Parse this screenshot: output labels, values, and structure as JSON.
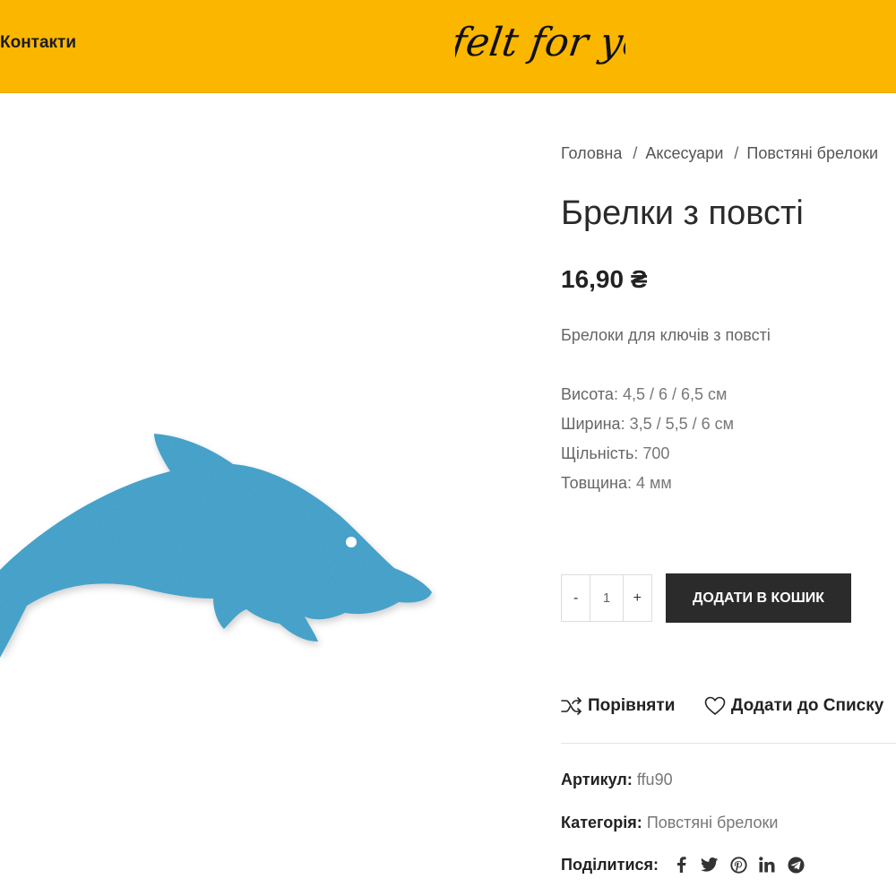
{
  "header": {
    "nav_contacts": "Контакти",
    "logo_text": "felt for you",
    "bg_color": "#fbb600"
  },
  "breadcrumb": {
    "items": [
      "Головна",
      "Аксесуари",
      "Повстяні брелоки"
    ],
    "separator": "/"
  },
  "product": {
    "title": "Брелки з повсті",
    "price": "16,90 ₴",
    "short_description": "Брелоки для ключів з повсті",
    "specs": [
      {
        "key": "Висота",
        "value": "4,5 / 6 / 6,5 см"
      },
      {
        "key": "Ширина",
        "value": "3,5 / 5,5 / 6 см"
      },
      {
        "key": "Щільність",
        "value": "700"
      },
      {
        "key": "Товщина",
        "value": "4 мм"
      }
    ],
    "image_icon": "blue-felt-dolphin",
    "image_color": "#3d9ec7"
  },
  "cart": {
    "minus": "-",
    "quantity": "1",
    "plus": "+",
    "add_to_cart": "ДОДАТИ В КОШИК"
  },
  "actions": {
    "compare": "Порівняти",
    "wishlist": "Додати до Списку"
  },
  "meta": {
    "sku_label": "Артикул:",
    "sku_value": "ffu90",
    "category_label": "Категорія:",
    "category_value": "Повстяні брелоки",
    "share_label": "Поділитися:",
    "share_icons": [
      "facebook-icon",
      "twitter-icon",
      "pinterest-icon",
      "linkedin-icon",
      "telegram-icon"
    ]
  }
}
